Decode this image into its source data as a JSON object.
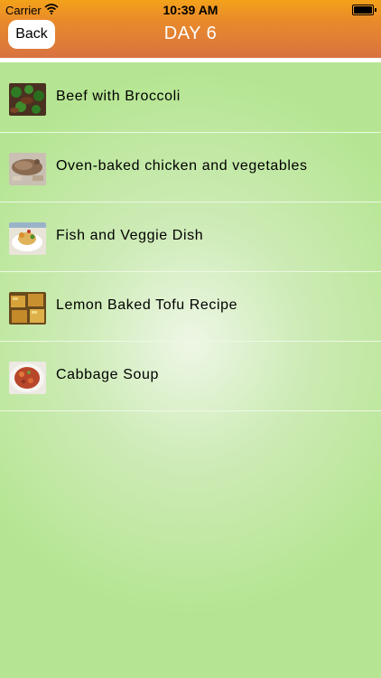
{
  "status_bar": {
    "carrier": "Carrier",
    "time": "10:39 AM"
  },
  "nav": {
    "back_label": "Back",
    "title": "DAY 6"
  },
  "recipes": [
    {
      "label": "Beef with Broccoli",
      "icon": "beef-broccoli-thumbnail"
    },
    {
      "label": "Oven-baked chicken and vegetables",
      "icon": "baked-chicken-thumbnail"
    },
    {
      "label": "Fish and Veggie Dish",
      "icon": "fish-veggie-thumbnail"
    },
    {
      "label": "Lemon Baked Tofu Recipe",
      "icon": "lemon-tofu-thumbnail"
    },
    {
      "label": "Cabbage Soup",
      "icon": "cabbage-soup-thumbnail"
    }
  ],
  "colors": {
    "nav_top": "#f4a21a",
    "nav_bottom": "#d97240",
    "background": "#b5e592",
    "title_text": "#ffffff"
  }
}
